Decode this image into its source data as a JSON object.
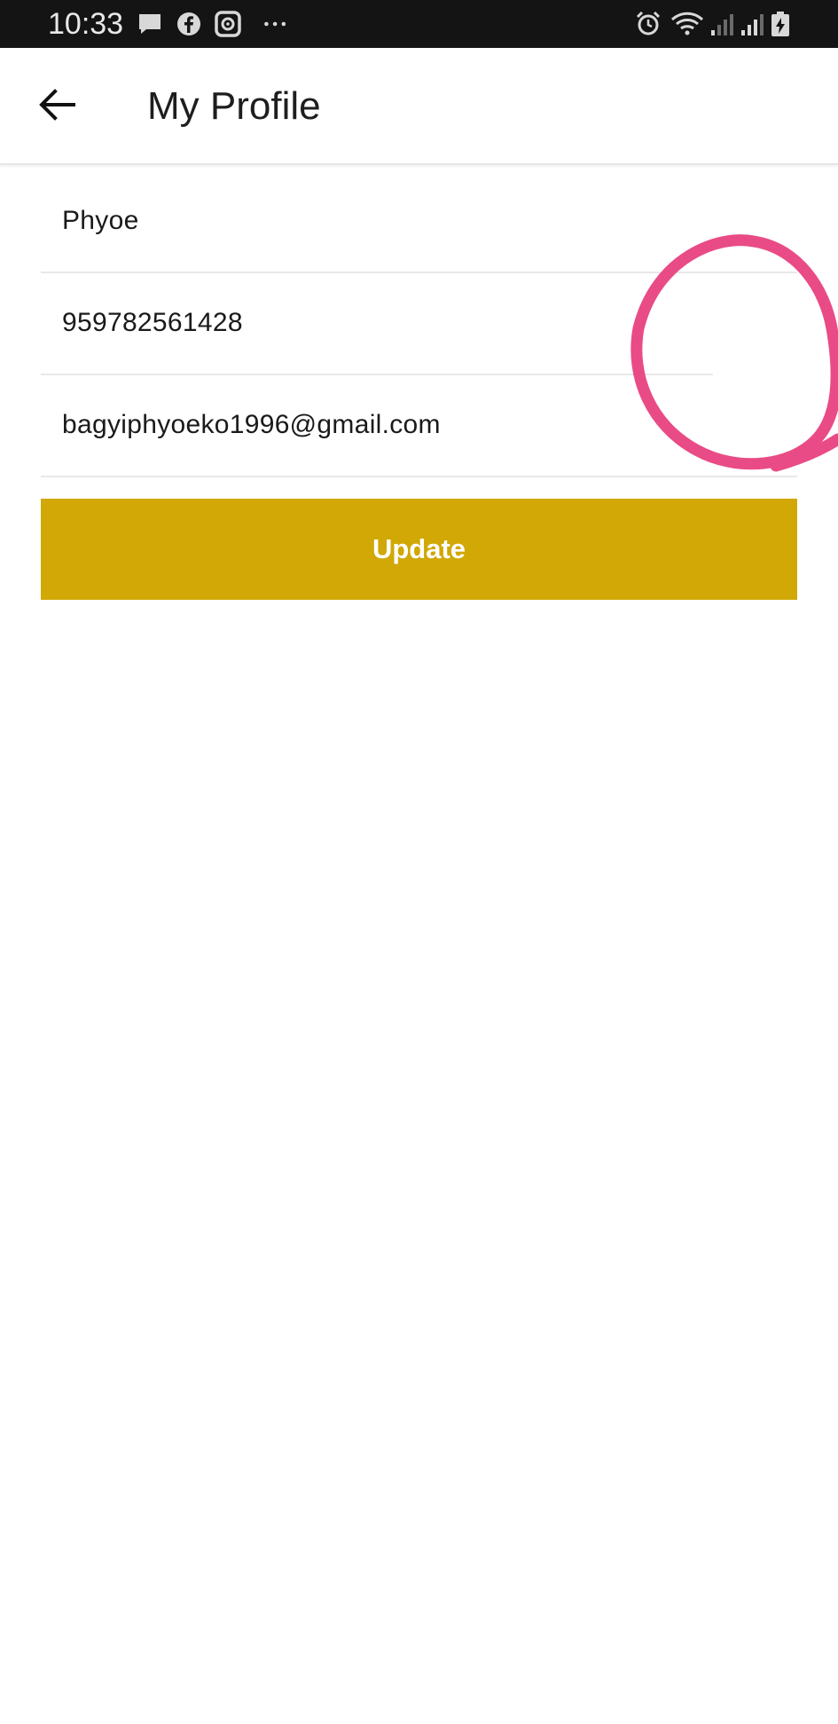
{
  "status_bar": {
    "time": "10:33",
    "left_icons": [
      "message-icon",
      "facebook-icon",
      "screen-record-icon",
      "more-dots-icon"
    ],
    "right_icons": [
      "alarm-icon",
      "wifi-icon",
      "signal-icon",
      "signal-icon",
      "battery-charging-icon"
    ]
  },
  "app_bar": {
    "back_icon": "arrow-left-icon",
    "title": "My Profile"
  },
  "form": {
    "name_value": "Phyoe",
    "phone_value": "959782561428",
    "email_value": "bagyiphyoeko1996@gmail.com",
    "update_label": "Update"
  },
  "colors": {
    "accent": "#d1a806",
    "status_bar": "#141414",
    "annotation": "#e94b86"
  }
}
